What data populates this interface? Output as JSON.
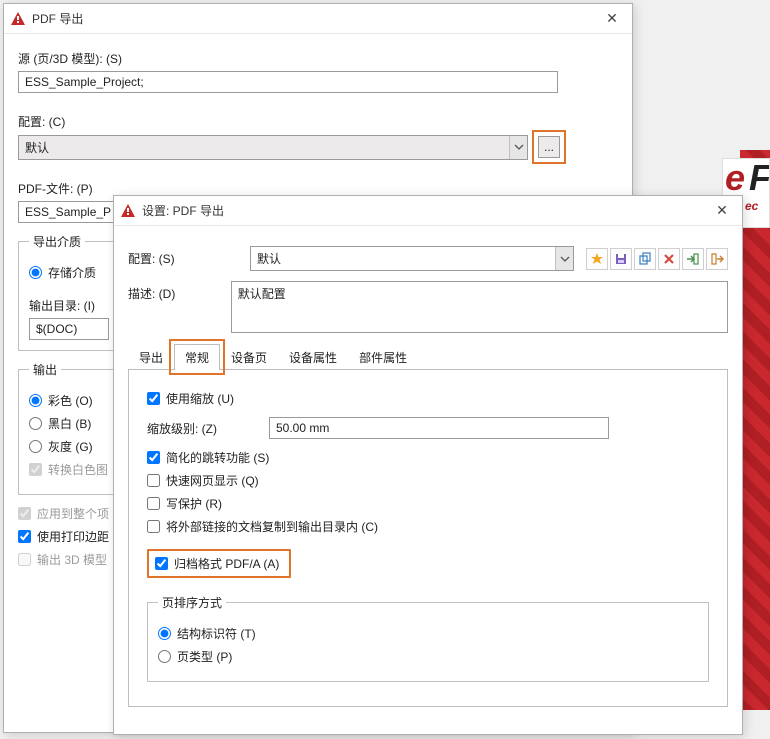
{
  "win1": {
    "title": "PDF 导出",
    "source_label": "源 (页/3D 模型): (S)",
    "source_value": "ESS_Sample_Project;",
    "config_label": "配置: (C)",
    "config_value": "默认",
    "browse_button": "...",
    "pdf_file_label": "PDF-文件: (P)",
    "pdf_file_value": "ESS_Sample_P",
    "media": {
      "legend": "导出介质",
      "storage": "存储介质",
      "output_dir_label": "输出目录: (I)",
      "output_dir_value": "$(DOC)"
    },
    "output": {
      "legend": "输出",
      "color": "彩色 (O)",
      "bw": "黑白 (B)",
      "gray": "灰度 (G)",
      "convert_white": "转换白色图"
    },
    "apply_whole": "应用到整个项",
    "use_print_margin": "使用打印边距",
    "output_3d": "输出 3D 模型"
  },
  "win2": {
    "title": "设置: PDF 导出",
    "config_label": "配置: (S)",
    "config_value": "默认",
    "desc_label": "描述: (D)",
    "desc_value": "默认配置",
    "tabs": {
      "export": "导出",
      "general": "常规",
      "device_page": "设备页",
      "device_attr": "设备属性",
      "part_attr": "部件属性"
    },
    "general": {
      "use_zoom": "使用缩放 (U)",
      "zoom_label": "缩放级别: (Z)",
      "zoom_value": "50.00 mm",
      "simplified_jump": "简化的跳转功能 (S)",
      "fast_web": "快速网页显示 (Q)",
      "write_protect": "写保护 (R)",
      "copy_ext_docs": "将外部链接的文档复制到输出目录内 (C)",
      "pdfa": "归档格式 PDF/A (A)",
      "sort_legend": "页排序方式",
      "sort_struct": "结构标识符 (T)",
      "sort_pagetype": "页类型 (P)"
    },
    "toolbar": {
      "new": "new",
      "save": "save",
      "copy": "copy",
      "delete": "delete",
      "import": "import",
      "export": "export"
    }
  }
}
